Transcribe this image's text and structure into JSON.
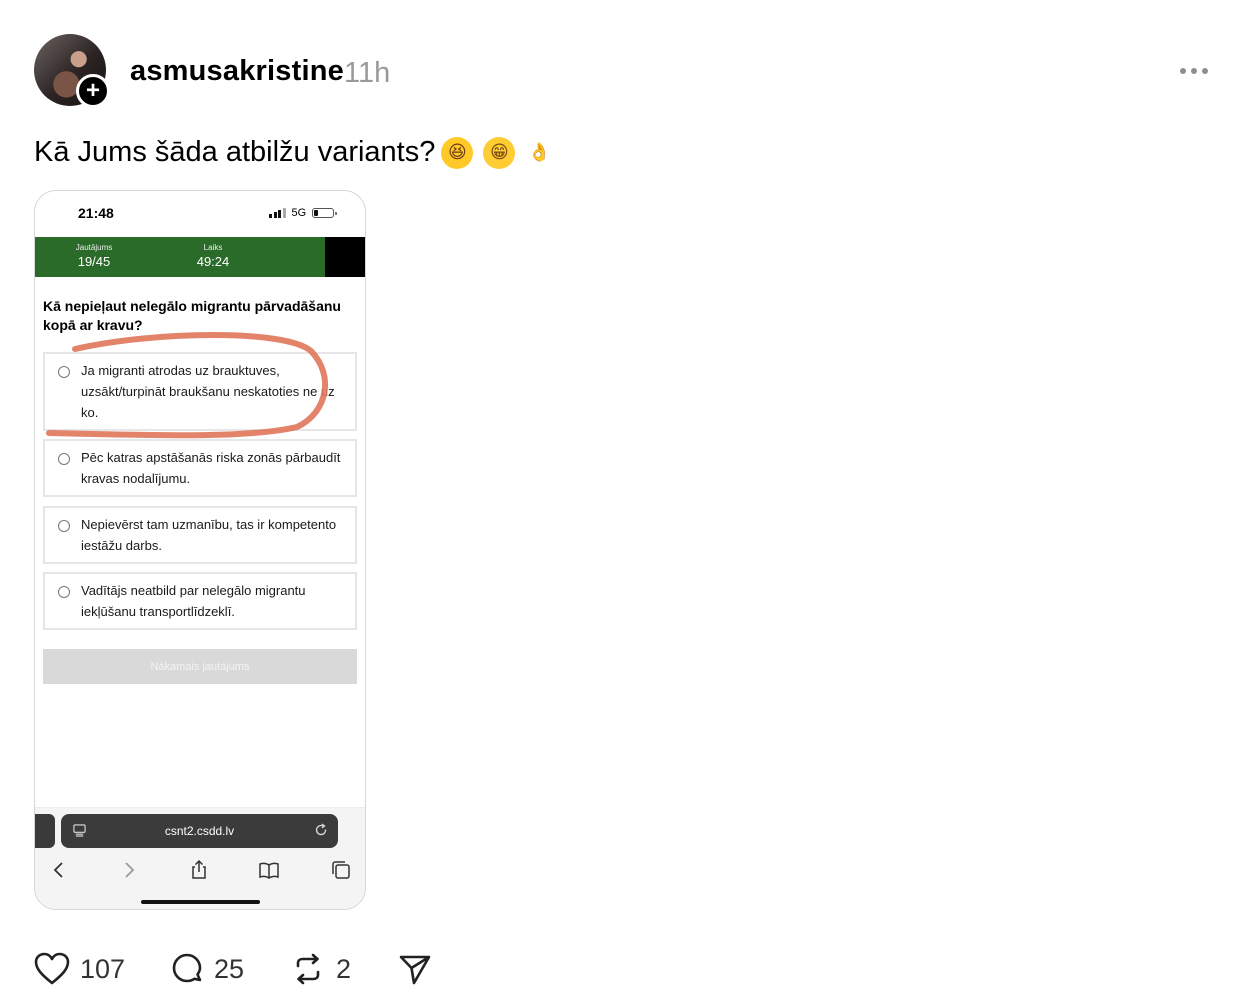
{
  "post": {
    "username": "asmusakristine",
    "time": "11h",
    "follow_badge": "+",
    "text": "Kā Jums šāda atbilžu variants?",
    "emojis": [
      "😆",
      "😁",
      "👌"
    ]
  },
  "screenshot": {
    "status_time": "21:48",
    "network": "5G",
    "quiz": {
      "question_label": "Jautājums",
      "question_value": "19/45",
      "time_label": "Laiks",
      "time_value": "49:24",
      "question": "Kā nepieļaut nelegālo migrantu pārvadāšanu kopā ar kravu?",
      "options": [
        "Ja migranti atrodas uz brauktuves, uzsākt/turpināt braukšanu neskatoties ne uz ko.",
        "Pēc katras apstāšanās riska zonās pārbaudīt kravas nodalījumu.",
        "Nepievērst tam uzmanību, tas ir kompetento iestāžu darbs.",
        "Vadītājs neatbild par nelegālo migrantu iekļūšanu transportlīdzeklī."
      ],
      "next_button": "Nākamais jautājums"
    },
    "url": "csnt2.csdd.lv",
    "header_green": "#2a6b2a",
    "annotation_color": "#e0785d"
  },
  "actions": {
    "likes": "107",
    "comments": "25",
    "reposts": "2"
  }
}
